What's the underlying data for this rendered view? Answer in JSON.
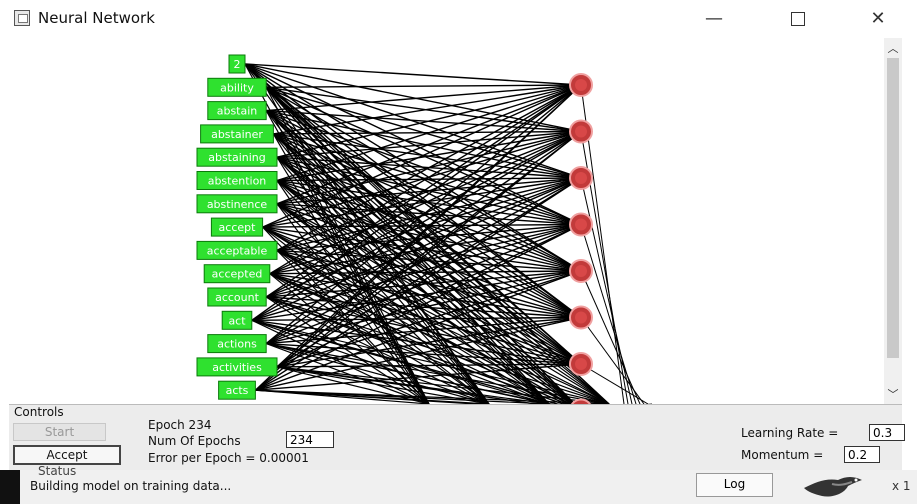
{
  "window": {
    "title": "Neural Network"
  },
  "network": {
    "input_labels": [
      "2",
      "ability",
      "abstain",
      "abstainer",
      "abstaining",
      "abstention",
      "abstinence",
      "accept",
      "acceptable",
      "accepted",
      "account",
      "act",
      "actions",
      "activities",
      "acts"
    ],
    "output_node_count": 8,
    "input_color": "#2fe12f",
    "output_color": "#c23a3a"
  },
  "controls": {
    "section_label": "Controls",
    "start_label": "Start",
    "accept_label": "Accept",
    "epoch_text": "Epoch  234",
    "num_epochs_label": "Num Of Epochs",
    "num_epochs_value": "234",
    "error_text": "Error per Epoch = 0.00001",
    "learning_rate_label": "Learning Rate =",
    "learning_rate_value": "0.3",
    "momentum_label": "Momentum =",
    "momentum_value": "0.2"
  },
  "status": {
    "title": "Status",
    "text": "Building model on training data...",
    "log_label": "Log",
    "zoom": "x 1"
  },
  "icons": [
    "app-icon",
    "minimize-icon",
    "maximize-icon",
    "close-icon",
    "scroll-up-icon",
    "scroll-down-icon",
    "bird-logo-icon"
  ]
}
